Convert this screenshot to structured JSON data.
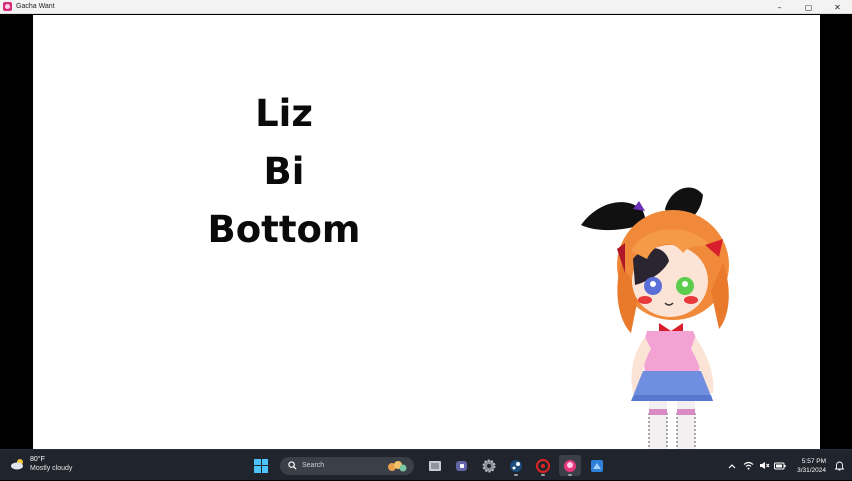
{
  "window": {
    "title": "Gacha Want",
    "controls": {
      "minimize": "–",
      "restore": "▢",
      "close": "✕"
    }
  },
  "scene": {
    "lines": [
      "Liz",
      "Bi",
      "Bottom"
    ]
  },
  "taskbar": {
    "weather": {
      "temp": "80°F",
      "desc": "Mostly cloudy",
      "icon": "cloud-icon"
    },
    "search_placeholder": "Search",
    "apps": [
      "start-icon",
      "search-icon",
      "file-manager-icon",
      "teams-icon",
      "settings-icon",
      "steam-icon",
      "app-red-icon",
      "gacha-app-icon",
      "store-icon"
    ],
    "tray": [
      "chevron-up-icon",
      "wifi-icon",
      "volume-muted-icon",
      "battery-icon"
    ],
    "clock": {
      "time": "5:57 PM",
      "date": "3/31/2024"
    }
  },
  "colors": {
    "taskbar_bg": "#20242c",
    "stage_bg": "#ffffff",
    "accent": "#4cc2ff"
  }
}
